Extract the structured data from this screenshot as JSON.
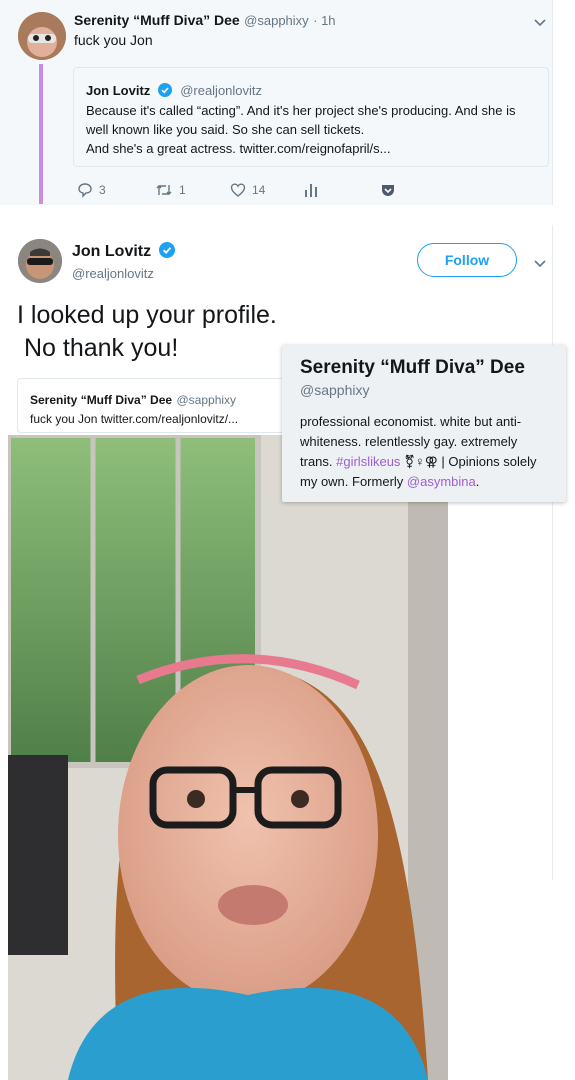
{
  "reply_tweet": {
    "display_name": "Serenity “Muff Diva” Dee",
    "handle": "@sapphixy",
    "time": "· 1h",
    "text": "fuck you Jon",
    "quoted": {
      "display_name": "Jon Lovitz",
      "handle": "@realjonlovitz",
      "lines": [
        "Because it's called “acting”.  And it's her project she's producing. And she is",
        "well known like you said. So she can sell tickets.",
        "And she's a great actress. twitter.com/reignofapril/s..."
      ]
    },
    "actions": {
      "replies": "3",
      "retweets": "1",
      "likes": "14"
    }
  },
  "main_tweet": {
    "display_name": "Jon Lovitz",
    "handle": "@realjonlovitz",
    "follow_label": "Follow",
    "text_line1": "I looked up your profile.",
    "text_line2": "No thank you!",
    "quoted": {
      "display_name": "Serenity “Muff Diva” Dee",
      "handle": "@sapphixy",
      "text": "fuck you Jon twitter.com/realjonlovitz/..."
    }
  },
  "profile_card": {
    "display_name": "Serenity “Muff Diva” Dee",
    "handle": "@sapphixy",
    "bio_part1": "professional economist. white but anti-whiteness. relentlessly gay. extremely trans. ",
    "hashtag": "#girlslikeus",
    "emoji": "⚧♀⚢",
    "bio_part2": " | Opinions solely my own. Formerly ",
    "mention": "@asymbina",
    "bio_end": "."
  },
  "colors": {
    "accent_blue": "#1da1f2",
    "thread_purple": "#c58ee0",
    "link_purple": "#9f5fd0",
    "muted_gray": "#657786"
  }
}
